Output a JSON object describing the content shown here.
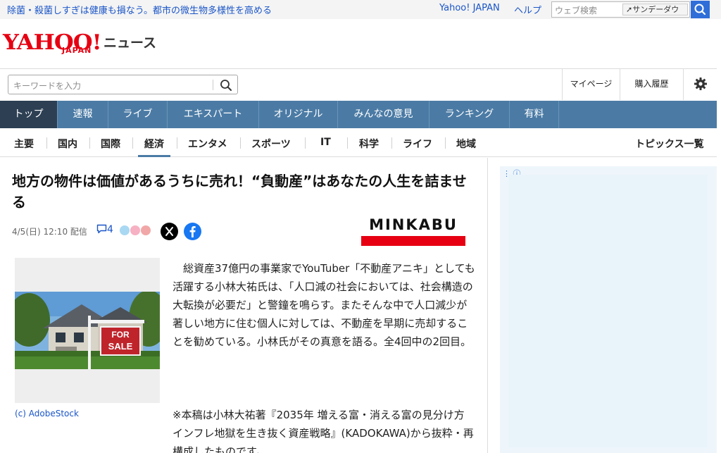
{
  "topbar": {
    "promo_text": "除菌・殺菌しすぎは健康も損なう。都市の微生物多様性を高める",
    "yahoo_japan_link": "Yahoo! JAPAN",
    "help_link": "ヘルプ",
    "web_search_placeholder": "ウェブ検索",
    "web_search_tag": "サンデーダウ"
  },
  "logo": {
    "brand": "YAHOO!",
    "brand_sub": "JAPAN",
    "service": "ニュース"
  },
  "header": {
    "keyword_placeholder": "キーワードを入力",
    "mypage": "マイページ",
    "purchase_history": "購入履歴"
  },
  "nav": {
    "items": [
      {
        "label": "トップ",
        "active": true
      },
      {
        "label": "速報"
      },
      {
        "label": "ライブ"
      },
      {
        "label": "エキスパート"
      },
      {
        "label": "オリジナル"
      },
      {
        "label": "みんなの意見"
      },
      {
        "label": "ランキング"
      },
      {
        "label": "有料"
      }
    ]
  },
  "subnav": {
    "items": [
      "主要",
      "国内",
      "国際",
      "経済",
      "エンタメ",
      "スポーツ",
      "IT",
      "科学",
      "ライフ",
      "地域"
    ],
    "active": "経済",
    "topics_all": "トピックス一覧"
  },
  "article": {
    "headline": "地方の物件は価値があるうちに売れ！“負動産”はあなたの人生を詰ませる",
    "date": "4/5(日) 12:10 配信",
    "comment_count": "4",
    "source_logo": "MINKABU",
    "photo_credit": "(c) AdobeStock",
    "photo_sign_line1": "FOR",
    "photo_sign_line2": "SALE",
    "body": "総資産37億円の事業家でYouTuber「不動産アニキ」としても活躍する小林大祐氏は、「人口減の社会においては、社会構造の大転換が必要だ」と警鐘を鳴らす。またそんな中で人口減少が著しい地方に住む個人に対しては、不動産を早期に売却することを勧めている。小林氏がその真意を語る。全4回中の2回目。",
    "note": "※本稿は小林大祐著『2035年 増える富・消える富の見分け方 インフレ地獄を生き抜く資産戦略』(KADOKAWA)から抜粋・再構成したものです。"
  },
  "colors": {
    "nav_bg": "#4b7ba5",
    "nav_active": "#2c3f53",
    "link": "#1a55c7",
    "brand_red": "#e60012"
  }
}
